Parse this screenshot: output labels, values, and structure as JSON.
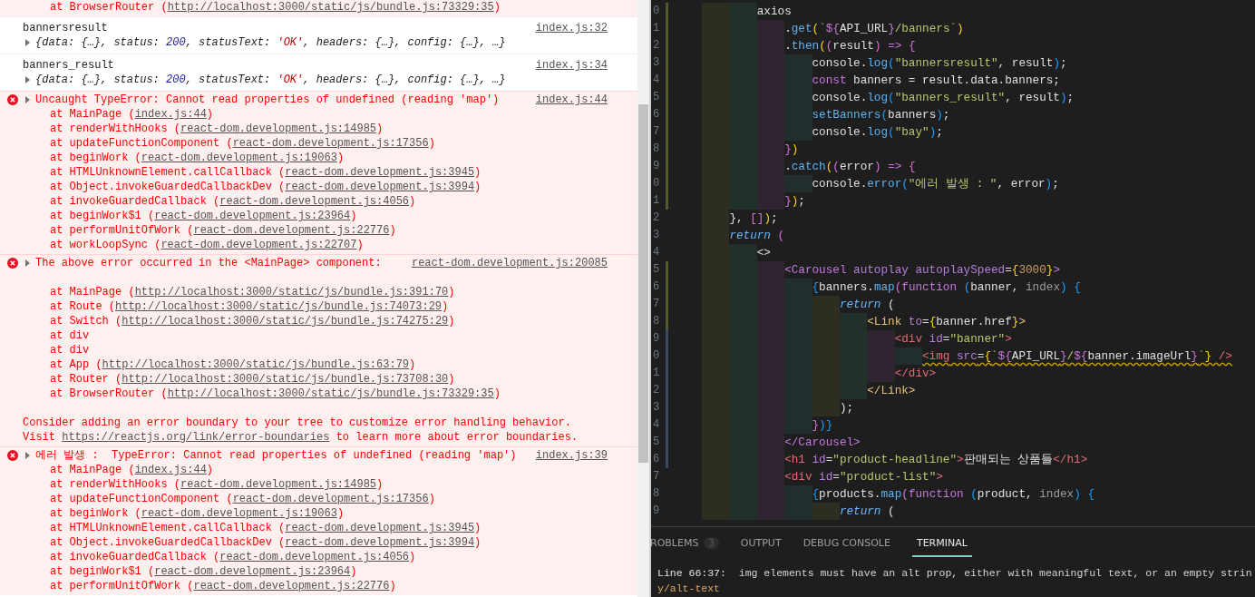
{
  "console": {
    "entries": [
      {
        "kind": "stack_tail",
        "frames": [
          {
            "text": "at BrowserRouter (",
            "link": "http://localhost:3000/static/js/bundle.js:73329:35",
            "end": ")"
          }
        ]
      },
      {
        "kind": "log",
        "message": "bannersresult",
        "source": "index.js:32",
        "preview": [
          {
            "text": "{data: {…}, status: ",
            "kind": "plain"
          },
          {
            "text": "200",
            "kind": "num"
          },
          {
            "text": ", statusText: ",
            "kind": "plain"
          },
          {
            "text": "'OK'",
            "kind": "str"
          },
          {
            "text": ", headers: {…}, config: {…}, …}",
            "kind": "plain"
          }
        ]
      },
      {
        "kind": "log",
        "message": "banners_result",
        "source": "index.js:34",
        "preview": [
          {
            "text": "{data: {…}, status: ",
            "kind": "plain"
          },
          {
            "text": "200",
            "kind": "num"
          },
          {
            "text": ", statusText: ",
            "kind": "plain"
          },
          {
            "text": "'OK'",
            "kind": "str"
          },
          {
            "text": ", headers: {…}, config: {…}, …}",
            "kind": "plain"
          }
        ]
      },
      {
        "kind": "error",
        "message": "Uncaught TypeError: Cannot read properties of undefined (reading 'map')",
        "source": "index.js:44",
        "frames": [
          {
            "text": "at MainPage (",
            "link": "index.js:44",
            "end": ")"
          },
          {
            "text": "at renderWithHooks (",
            "link": "react-dom.development.js:14985",
            "end": ")"
          },
          {
            "text": "at updateFunctionComponent (",
            "link": "react-dom.development.js:17356",
            "end": ")"
          },
          {
            "text": "at beginWork (",
            "link": "react-dom.development.js:19063",
            "end": ")"
          },
          {
            "text": "at HTMLUnknownElement.callCallback (",
            "link": "react-dom.development.js:3945",
            "end": ")"
          },
          {
            "text": "at Object.invokeGuardedCallbackDev (",
            "link": "react-dom.development.js:3994",
            "end": ")"
          },
          {
            "text": "at invokeGuardedCallback (",
            "link": "react-dom.development.js:4056",
            "end": ")"
          },
          {
            "text": "at beginWork$1 (",
            "link": "react-dom.development.js:23964",
            "end": ")"
          },
          {
            "text": "at performUnitOfWork (",
            "link": "react-dom.development.js:22776",
            "end": ")"
          },
          {
            "text": "at workLoopSync (",
            "link": "react-dom.development.js:22707",
            "end": ")"
          }
        ]
      },
      {
        "kind": "error",
        "message": "The above error occurred in the <MainPage> component:",
        "source": "react-dom.development.js:20085",
        "frames": [
          {
            "text": "at MainPage (",
            "link": "http://localhost:3000/static/js/bundle.js:391:70",
            "end": ")"
          },
          {
            "text": "at Route (",
            "link": "http://localhost:3000/static/js/bundle.js:74073:29",
            "end": ")"
          },
          {
            "text": "at Switch (",
            "link": "http://localhost:3000/static/js/bundle.js:74275:29",
            "end": ")"
          },
          {
            "text": "at div"
          },
          {
            "text": "at div"
          },
          {
            "text": "at App (",
            "link": "http://localhost:3000/static/js/bundle.js:63:79",
            "end": ")"
          },
          {
            "text": "at Router (",
            "link": "http://localhost:3000/static/js/bundle.js:73708:30",
            "end": ")"
          },
          {
            "text": "at BrowserRouter (",
            "link": "http://localhost:3000/static/js/bundle.js:73329:35",
            "end": ")"
          }
        ],
        "notes": [
          {
            "text": "Consider adding an error boundary to your tree to customize error handling behavior."
          },
          {
            "text": "Visit ",
            "link": "https://reactjs.org/link/error-boundaries",
            "end": " to learn more about error boundaries."
          }
        ]
      },
      {
        "kind": "error",
        "message": "에러 발생 :  TypeError: Cannot read properties of undefined (reading 'map')",
        "source": "index.js:39",
        "frames": [
          {
            "text": "at MainPage (",
            "link": "index.js:44",
            "end": ")"
          },
          {
            "text": "at renderWithHooks (",
            "link": "react-dom.development.js:14985",
            "end": ")"
          },
          {
            "text": "at updateFunctionComponent (",
            "link": "react-dom.development.js:17356",
            "end": ")"
          },
          {
            "text": "at beginWork (",
            "link": "react-dom.development.js:19063",
            "end": ")"
          },
          {
            "text": "at HTMLUnknownElement.callCallback (",
            "link": "react-dom.development.js:3945",
            "end": ")"
          },
          {
            "text": "at Object.invokeGuardedCallbackDev (",
            "link": "react-dom.development.js:3994",
            "end": ")"
          },
          {
            "text": "at invokeGuardedCallback (",
            "link": "react-dom.development.js:4056",
            "end": ")"
          },
          {
            "text": "at beginWork$1 (",
            "link": "react-dom.development.js:23964",
            "end": ")"
          },
          {
            "text": "at performUnitOfWork (",
            "link": "react-dom.development.js:22776",
            "end": ")"
          }
        ]
      }
    ]
  },
  "editor": {
    "lines": [
      {
        "number": "0",
        "kind": "added",
        "tokens": [
          {
            "text": "        axios",
            "kind": "plain"
          }
        ]
      },
      {
        "number": "1",
        "kind": "added",
        "tokens": [
          {
            "text": "            .",
            "kind": "plain"
          },
          {
            "text": "get",
            "kind": "fn"
          },
          {
            "text": "(",
            "kind": "b1"
          },
          {
            "text": "`",
            "kind": "str"
          },
          {
            "text": "${",
            "kind": "kw"
          },
          {
            "text": "API_URL",
            "kind": "plain"
          },
          {
            "text": "}",
            "kind": "kw"
          },
          {
            "text": "/banners`",
            "kind": "str"
          },
          {
            "text": ")",
            "kind": "b1"
          }
        ]
      },
      {
        "number": "2",
        "kind": "added",
        "tokens": [
          {
            "text": "            .",
            "kind": "plain"
          },
          {
            "text": "then",
            "kind": "fn"
          },
          {
            "text": "(",
            "kind": "b1"
          },
          {
            "text": "(",
            "kind": "b2"
          },
          {
            "text": "result",
            "kind": "plain"
          },
          {
            "text": ")",
            "kind": "b2"
          },
          {
            "text": " => ",
            "kind": "kw"
          },
          {
            "text": "{",
            "kind": "b2"
          }
        ]
      },
      {
        "number": "3",
        "kind": "added",
        "tokens": [
          {
            "text": "                console.",
            "kind": "plain"
          },
          {
            "text": "log",
            "kind": "fn"
          },
          {
            "text": "(",
            "kind": "b3"
          },
          {
            "text": "\"bannersresult\"",
            "kind": "str"
          },
          {
            "text": ", result",
            "kind": "plain"
          },
          {
            "text": ")",
            "kind": "b3"
          },
          {
            "text": ";",
            "kind": "plain"
          }
        ]
      },
      {
        "number": "4",
        "kind": "added",
        "tokens": [
          {
            "text": "                const",
            "kind": "kw"
          },
          {
            "text": " banners = result.data.banners;",
            "kind": "plain"
          }
        ]
      },
      {
        "number": "5",
        "kind": "added",
        "tokens": [
          {
            "text": "                console.",
            "kind": "plain"
          },
          {
            "text": "log",
            "kind": "fn"
          },
          {
            "text": "(",
            "kind": "b3"
          },
          {
            "text": "\"banners_result\"",
            "kind": "str"
          },
          {
            "text": ", result",
            "kind": "plain"
          },
          {
            "text": ")",
            "kind": "b3"
          },
          {
            "text": ";",
            "kind": "plain"
          }
        ]
      },
      {
        "number": "6",
        "kind": "added",
        "tokens": [
          {
            "text": "                setBanners",
            "kind": "fn"
          },
          {
            "text": "(",
            "kind": "b3"
          },
          {
            "text": "banners",
            "kind": "plain"
          },
          {
            "text": ")",
            "kind": "b3"
          },
          {
            "text": ";",
            "kind": "plain"
          }
        ]
      },
      {
        "number": "7",
        "kind": "added",
        "tokens": [
          {
            "text": "                console.",
            "kind": "plain"
          },
          {
            "text": "log",
            "kind": "fn"
          },
          {
            "text": "(",
            "kind": "b3"
          },
          {
            "text": "\"bay\"",
            "kind": "str"
          },
          {
            "text": ")",
            "kind": "b3"
          },
          {
            "text": ";",
            "kind": "plain"
          }
        ]
      },
      {
        "number": "8",
        "kind": "added",
        "tokens": [
          {
            "text": "            }",
            "kind": "b2"
          },
          {
            "text": ")",
            "kind": "b1"
          }
        ]
      },
      {
        "number": "9",
        "kind": "added",
        "tokens": [
          {
            "text": "            .",
            "kind": "plain"
          },
          {
            "text": "catch",
            "kind": "fn"
          },
          {
            "text": "(",
            "kind": "b1"
          },
          {
            "text": "(",
            "kind": "b2"
          },
          {
            "text": "error",
            "kind": "plain"
          },
          {
            "text": ")",
            "kind": "b2"
          },
          {
            "text": " => ",
            "kind": "kw"
          },
          {
            "text": "{",
            "kind": "b2"
          }
        ]
      },
      {
        "number": "0",
        "kind": "added",
        "tokens": [
          {
            "text": "                console.",
            "kind": "plain"
          },
          {
            "text": "error",
            "kind": "fn"
          },
          {
            "text": "(",
            "kind": "b3"
          },
          {
            "text": "\"에러 발생 : \"",
            "kind": "str"
          },
          {
            "text": ", error",
            "kind": "plain"
          },
          {
            "text": ")",
            "kind": "b3"
          },
          {
            "text": ";",
            "kind": "plain"
          }
        ]
      },
      {
        "number": "1",
        "kind": "added",
        "tokens": [
          {
            "text": "            }",
            "kind": "b2"
          },
          {
            "text": ")",
            "kind": "b1"
          },
          {
            "text": ";",
            "kind": "plain"
          }
        ]
      },
      {
        "number": "2",
        "kind": "unchanged",
        "tokens": [
          {
            "text": "    }",
            "kind": "plain"
          },
          {
            "text": ", ",
            "kind": "plain"
          },
          {
            "text": "[]",
            "kind": "b2"
          },
          {
            "text": ")",
            "kind": "b1"
          },
          {
            "text": ";",
            "kind": "plain"
          }
        ]
      },
      {
        "number": "3",
        "kind": "unchanged",
        "tokens": [
          {
            "text": "    return",
            "kind": "ret"
          },
          {
            "text": " (",
            "kind": "b2"
          }
        ]
      },
      {
        "number": "4",
        "kind": "unchanged",
        "tokens": [
          {
            "text": "        <>",
            "kind": "plain"
          }
        ]
      },
      {
        "number": "5",
        "kind": "added",
        "tokens": [
          {
            "text": "            <Carousel",
            "kind": "tagp"
          },
          {
            "text": " autoplay autoplaySpeed",
            "kind": "attr"
          },
          {
            "text": "=",
            "kind": "plain"
          },
          {
            "text": "{",
            "kind": "b1"
          },
          {
            "text": "3000",
            "kind": "num"
          },
          {
            "text": "}",
            "kind": "b1"
          },
          {
            "text": ">",
            "kind": "tagp"
          }
        ]
      },
      {
        "number": "6",
        "kind": "added",
        "tokens": [
          {
            "text": "                {",
            "kind": "b3"
          },
          {
            "text": "banners.",
            "kind": "plain"
          },
          {
            "text": "map",
            "kind": "fn"
          },
          {
            "text": "(",
            "kind": "b2"
          },
          {
            "text": "function",
            "kind": "kw"
          },
          {
            "text": " (",
            "kind": "b3"
          },
          {
            "text": "banner, ",
            "kind": "plain"
          },
          {
            "text": "index",
            "kind": "dim"
          },
          {
            "text": ") {",
            "kind": "b3"
          }
        ]
      },
      {
        "number": "7",
        "kind": "added",
        "tokens": [
          {
            "text": "                    return",
            "kind": "ret"
          },
          {
            "text": " (",
            "kind": "plain"
          }
        ]
      },
      {
        "number": "8",
        "kind": "added",
        "tokens": [
          {
            "text": "                        <Link",
            "kind": "tagy"
          },
          {
            "text": " to",
            "kind": "attr"
          },
          {
            "text": "=",
            "kind": "plain"
          },
          {
            "text": "{",
            "kind": "b1"
          },
          {
            "text": "banner.href",
            "kind": "plain"
          },
          {
            "text": "}",
            "kind": "b1"
          },
          {
            "text": ">",
            "kind": "tagy"
          }
        ]
      },
      {
        "number": "9",
        "kind": "modified",
        "tokens": [
          {
            "text": "                            <div",
            "kind": "tagr"
          },
          {
            "text": " id",
            "kind": "attr"
          },
          {
            "text": "=",
            "kind": "plain"
          },
          {
            "text": "\"banner\"",
            "kind": "str"
          },
          {
            "text": ">",
            "kind": "tagr"
          }
        ]
      },
      {
        "number": "0",
        "kind": "modified",
        "warning": true,
        "tokens": [
          {
            "text": "                                <img",
            "kind": "tagr"
          },
          {
            "text": " src",
            "kind": "attr"
          },
          {
            "text": "=",
            "kind": "plain"
          },
          {
            "text": "{",
            "kind": "b1"
          },
          {
            "text": "`",
            "kind": "str"
          },
          {
            "text": "${",
            "kind": "kw"
          },
          {
            "text": "API_URL",
            "kind": "plain"
          },
          {
            "text": "}",
            "kind": "kw"
          },
          {
            "text": "/",
            "kind": "str"
          },
          {
            "text": "${",
            "kind": "kw"
          },
          {
            "text": "banner.imageUrl",
            "kind": "plain"
          },
          {
            "text": "}",
            "kind": "kw"
          },
          {
            "text": "`",
            "kind": "str"
          },
          {
            "text": "}",
            "kind": "b1"
          },
          {
            "text": " />",
            "kind": "tagr"
          }
        ]
      },
      {
        "number": "1",
        "kind": "modified",
        "tokens": [
          {
            "text": "                            </div>",
            "kind": "tagr"
          }
        ]
      },
      {
        "number": "2",
        "kind": "modified",
        "tokens": [
          {
            "text": "                        </Link>",
            "kind": "tagy"
          }
        ]
      },
      {
        "number": "3",
        "kind": "modified",
        "tokens": [
          {
            "text": "                    );",
            "kind": "plain"
          }
        ]
      },
      {
        "number": "4",
        "kind": "modified",
        "tokens": [
          {
            "text": "                }",
            "kind": "b2"
          },
          {
            "text": ")",
            "kind": "b3"
          },
          {
            "text": "}",
            "kind": "b3"
          }
        ]
      },
      {
        "number": "5",
        "kind": "modified",
        "tokens": [
          {
            "text": "            </Carousel>",
            "kind": "tagp"
          }
        ]
      },
      {
        "number": "6",
        "kind": "modified",
        "tokens": [
          {
            "text": "            <h1",
            "kind": "tagr"
          },
          {
            "text": " id",
            "kind": "attr"
          },
          {
            "text": "=",
            "kind": "plain"
          },
          {
            "text": "\"product-headline\"",
            "kind": "str"
          },
          {
            "text": ">",
            "kind": "tagr"
          },
          {
            "text": "판매되는 상품들",
            "kind": "plain"
          },
          {
            "text": "</h1>",
            "kind": "tagr"
          }
        ]
      },
      {
        "number": "7",
        "kind": "unchanged",
        "tokens": [
          {
            "text": "            <div",
            "kind": "tagr"
          },
          {
            "text": " id",
            "kind": "attr"
          },
          {
            "text": "=",
            "kind": "plain"
          },
          {
            "text": "\"product-list\"",
            "kind": "str"
          },
          {
            "text": ">",
            "kind": "tagr"
          }
        ]
      },
      {
        "number": "8",
        "kind": "unchanged",
        "tokens": [
          {
            "text": "                {",
            "kind": "b3"
          },
          {
            "text": "products.",
            "kind": "plain"
          },
          {
            "text": "map",
            "kind": "fn"
          },
          {
            "text": "(",
            "kind": "b2"
          },
          {
            "text": "function",
            "kind": "kw"
          },
          {
            "text": " (",
            "kind": "b3"
          },
          {
            "text": "product, ",
            "kind": "plain"
          },
          {
            "text": "index",
            "kind": "dim"
          },
          {
            "text": ") {",
            "kind": "b3"
          }
        ]
      },
      {
        "number": "9",
        "kind": "unchanged",
        "tokens": [
          {
            "text": "                    return",
            "kind": "ret"
          },
          {
            "text": " (",
            "kind": "plain"
          }
        ]
      }
    ]
  },
  "panel": {
    "tabs": [
      {
        "label": "ROBLEMS",
        "badge": "3",
        "selected": false
      },
      {
        "label": "OUTPUT",
        "selected": false
      },
      {
        "label": "DEBUG CONSOLE",
        "selected": false
      },
      {
        "label": "TERMINAL",
        "selected": true
      }
    ],
    "terminal_lines": [
      {
        "segments": [
          {
            "text": "Line 66:37:",
            "kind": "loc"
          },
          {
            "text": "  img elements must have an alt prop, either with meaningful text, or an empty strin",
            "kind": "msg"
          }
        ]
      },
      {
        "segments": [
          {
            "text": "y/alt-text",
            "kind": "rule"
          }
        ]
      }
    ]
  }
}
